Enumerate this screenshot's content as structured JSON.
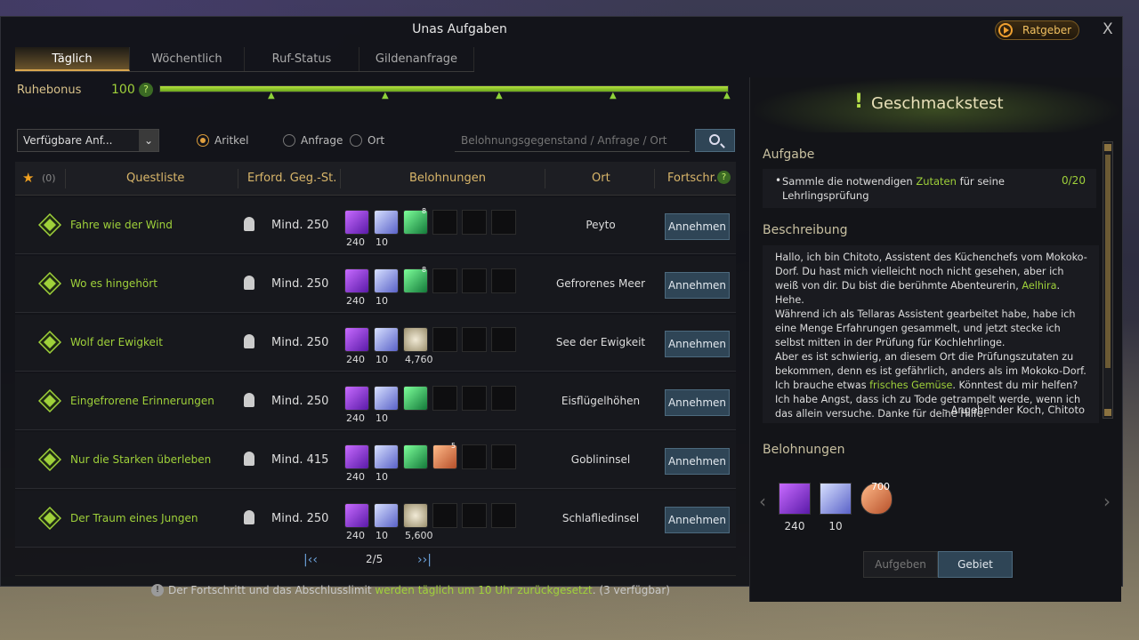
{
  "window": {
    "title": "Unas Aufgaben",
    "advisor_label": "Ratgeber",
    "close_label": "X"
  },
  "tabs": [
    {
      "label": "Täglich",
      "active": true
    },
    {
      "label": "Wöchentlich",
      "active": false
    },
    {
      "label": "Ruf-Status",
      "active": false
    },
    {
      "label": "Gildenanfrage",
      "active": false
    }
  ],
  "rest_bonus": {
    "label": "Ruhebonus",
    "value": "100",
    "help_label": "?",
    "fill_fraction": 1.0
  },
  "filters": {
    "dropdown_value": "Verfügbare Anf...",
    "radios": [
      {
        "label": "Aritkel",
        "selected": true
      },
      {
        "label": "Anfrage",
        "selected": false
      },
      {
        "label": "Ort",
        "selected": false
      }
    ],
    "search_placeholder": "Belohnungsgegenstand / Anfrage / Ort"
  },
  "table": {
    "favorites_count": "(0)",
    "headers": {
      "quest": "Questliste",
      "level": "Erford. Geg.-St.",
      "rewards": "Belohnungen",
      "location": "Ort",
      "progress": "Fortschr."
    },
    "rows": [
      {
        "name": "Fahre wie der Wind",
        "level": "Mind. 250",
        "rewards": [
          {
            "icon": "purple-gem",
            "count": "240"
          },
          {
            "icon": "blue-crystal",
            "count": "10"
          },
          {
            "icon": "green-tree",
            "count": "8"
          }
        ],
        "location": "Peyto",
        "action": "Annehmen"
      },
      {
        "name": "Wo es hingehört",
        "level": "Mind. 250",
        "rewards": [
          {
            "icon": "purple-gem",
            "count": "240"
          },
          {
            "icon": "blue-crystal",
            "count": "10"
          },
          {
            "icon": "green-tree",
            "count": "8"
          }
        ],
        "location": "Gefrorenes Meer",
        "action": "Annehmen"
      },
      {
        "name": "Wolf der Ewigkeit",
        "level": "Mind. 250",
        "rewards": [
          {
            "icon": "purple-gem",
            "count": "240"
          },
          {
            "icon": "blue-crystal",
            "count": "10"
          },
          {
            "icon": "silver-coin",
            "count": "4,760"
          }
        ],
        "location": "See der Ewigkeit",
        "action": "Annehmen"
      },
      {
        "name": "Eingefrorene Erinnerungen",
        "level": "Mind. 250",
        "rewards": [
          {
            "icon": "purple-gem",
            "count": "240"
          },
          {
            "icon": "blue-crystal",
            "count": "10"
          },
          {
            "icon": "green-stone",
            "count": ""
          }
        ],
        "location": "Eisflügelhöhen",
        "action": "Annehmen"
      },
      {
        "name": "Nur die Starken überleben",
        "level": "Mind. 415",
        "rewards": [
          {
            "icon": "purple-gem",
            "count": "240"
          },
          {
            "icon": "blue-crystal",
            "count": "10"
          },
          {
            "icon": "green-stone",
            "count": ""
          },
          {
            "icon": "orange-card",
            "count": "5"
          }
        ],
        "location": "Goblininsel",
        "action": "Annehmen"
      },
      {
        "name": "Der Traum eines Jungen",
        "level": "Mind. 250",
        "rewards": [
          {
            "icon": "purple-gem",
            "count": "240"
          },
          {
            "icon": "blue-crystal",
            "count": "10"
          },
          {
            "icon": "silver-coin",
            "count": "5,600"
          }
        ],
        "location": "Schlafliedinsel",
        "action": "Annehmen"
      }
    ]
  },
  "pagination": {
    "first": "K",
    "prev": "<",
    "page": "2/5",
    "next": ">",
    "last": "K"
  },
  "footer": {
    "text_before": "Der Fortschritt und das Abschlusslimit ",
    "highlight": "werden täglich um 10 Uhr zurückgesetzt",
    "text_after": ". (3 verfügbar)"
  },
  "detail": {
    "title": "Geschmackstest",
    "task_section": "Aufgabe",
    "task_text_before": "Sammle die notwendigen ",
    "task_highlight": "Zutaten",
    "task_text_after": " für seine Lehrlingsprüfung",
    "task_progress": "0/20",
    "desc_section": "Beschreibung",
    "desc_part1": "Hallo, ich bin Chitoto, Assistent des Küchenchefs vom Mokoko-Dorf. Du hast mich vielleicht noch nicht gesehen, aber ich weiß von dir. Du bist die berühmte Abenteurerin, ",
    "desc_name": "Aelhira",
    "desc_part2": ". Hehe.",
    "desc_part3": "Während ich als Tellaras Assistent gearbeitet habe, habe ich eine Menge Erfahrungen gesammelt, und jetzt stecke ich selbst mitten in der Prüfung für Kochlehrlinge.",
    "desc_part4": "Aber es ist schwierig, an diesem Ort die Prüfungszutaten zu bekommen, denn es ist gefährlich, anders als im Mokoko-Dorf.",
    "desc_part5a": "Ich brauche etwas ",
    "desc_part5hl": "frisches Gemüse",
    "desc_part5b": ". Könntest du mir helfen?",
    "desc_part6": "Ich habe Angst, dass ich zu Tode getrampelt werde, wenn ich das allein versuche. Danke für deine Hilfe!",
    "desc_sign": "– Angehender Koch, Chitoto",
    "rewards_section": "Belohnungen",
    "rewards": [
      {
        "icon": "purple-gem",
        "count": "240"
      },
      {
        "icon": "blue-crystal",
        "count": "10"
      },
      {
        "icon": "orange-heart",
        "count": "700"
      }
    ],
    "button_abandon": "Aufgeben",
    "button_area": "Gebiet"
  }
}
